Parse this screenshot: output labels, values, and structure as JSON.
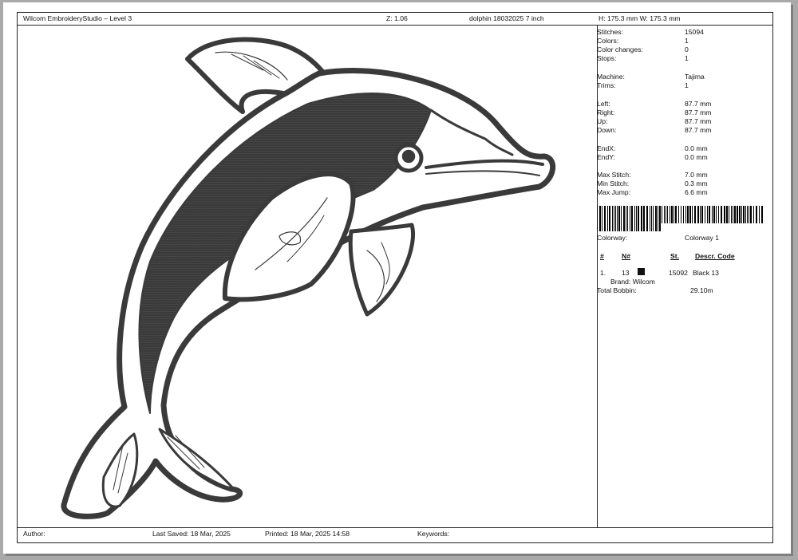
{
  "header": {
    "app_title": "Wilcom EmbroideryStudio – Level 3",
    "zoom": "Z: 1.06",
    "design_name": "dolphin 18032025 7 inch",
    "size": "H: 175.3 mm  W: 175.3 mm"
  },
  "stats": {
    "stitches_label": "Stitches:",
    "stitches": "15094",
    "colors_label": "Colors:",
    "colors": "1",
    "color_changes_label": "Color changes:",
    "color_changes": "0",
    "stops_label": "Stops:",
    "stops": "1",
    "machine_label": "Machine:",
    "machine": "Tajima",
    "trims_label": "Trims:",
    "trims": "1",
    "left_label": "Left:",
    "left": "87.7 mm",
    "right_label": "Right:",
    "right": "87.7 mm",
    "up_label": "Up:",
    "up": "87.7 mm",
    "down_label": "Down:",
    "down": "87.7 mm",
    "endx_label": "EndX:",
    "endx": "0.0 mm",
    "endy_label": "EndY:",
    "endy": "0.0 mm",
    "max_stitch_label": "Max Stitch:",
    "max_stitch": "7.0 mm",
    "min_stitch_label": "Min Stitch:",
    "min_stitch": "0.3 mm",
    "max_jump_label": "Max Jump:",
    "max_jump": "6.6 mm"
  },
  "colorway": {
    "label": "Colorway:",
    "value": "Colorway 1",
    "headers": [
      "#",
      "N#",
      "St.",
      "Descr. Code"
    ],
    "row": {
      "num": "1.",
      "n": "13",
      "swatch_color": "#111111",
      "st": "15092",
      "descr": "Black 13",
      "brand": "Brand: Wilcom"
    },
    "bobbin_label": "Total Bobbin:",
    "bobbin": "29.10m"
  },
  "footer": {
    "author": "Author:",
    "last_saved": "Last Saved: 18 Mar, 2025",
    "printed": "Printed: 18 Mar, 2025 14:58",
    "keywords": "Keywords:"
  },
  "colors": {
    "thread": "#3a3a3a",
    "background": "#a9a9a9"
  }
}
